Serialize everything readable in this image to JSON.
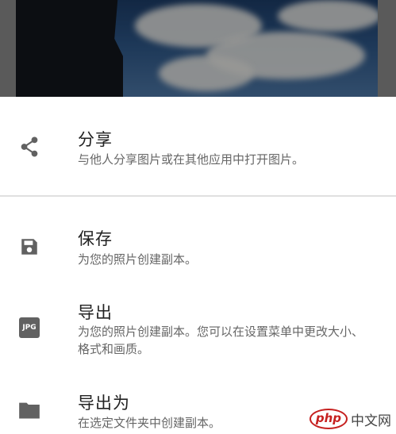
{
  "menu": {
    "items": [
      {
        "icon": "share-icon",
        "title": "分享",
        "description": "与他人分享图片或在其他应用中打开图片。"
      },
      {
        "icon": "save-icon",
        "title": "保存",
        "description": "为您的照片创建副本。"
      },
      {
        "icon": "jpg-icon",
        "icon_label": "JPG",
        "title": "导出",
        "description": "为您的照片创建副本。您可以在设置菜单中更改大小、格式和画质。"
      },
      {
        "icon": "folder-icon",
        "title": "导出为",
        "description": "在选定文件夹中创建副本。"
      }
    ]
  },
  "watermark": {
    "logo": "php",
    "text": "中文网"
  },
  "colors": {
    "icon": "#616161",
    "title": "#222222",
    "description": "#666666",
    "divider": "#e0e0e0"
  }
}
